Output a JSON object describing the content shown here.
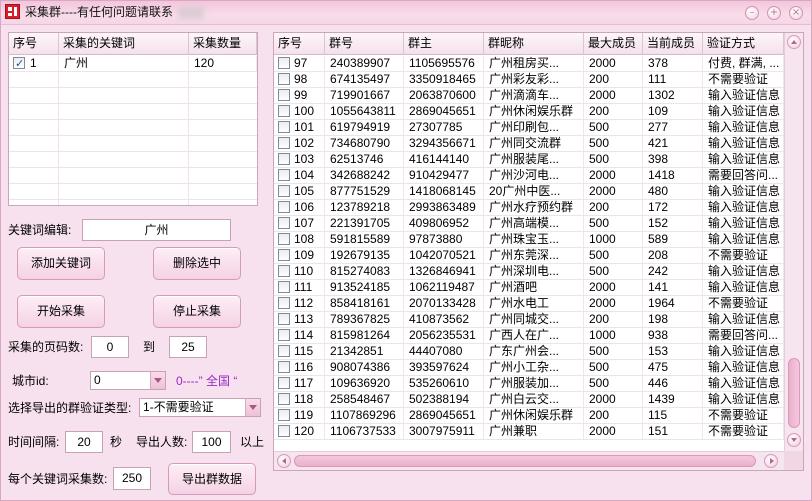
{
  "theme": {
    "background": "#f7e1ee",
    "accent": "#eab0cd",
    "hint_color": "#9a2bc5",
    "check_color": "#1f4fa0"
  },
  "window": {
    "title": "采集群----有任何问题请联系",
    "icon": "app-logo-icon",
    "controls": [
      "minimize-icon",
      "maximize-icon",
      "close-icon"
    ]
  },
  "keyword_table": {
    "columns": [
      "序号",
      "采集的关键词",
      "采集数量"
    ],
    "rows": [
      {
        "checked": true,
        "index": "1",
        "keyword": "广州",
        "count": "120"
      }
    ]
  },
  "keyword_editor": {
    "label": "关键词编辑:",
    "value": "广州"
  },
  "buttons": {
    "add_keyword": "添加关键词",
    "delete_selected": "删除选中",
    "start": "开始采集",
    "stop": "停止采集",
    "export": "导出群数据"
  },
  "page_range": {
    "label": "采集的页码数:",
    "from": "0",
    "separator": "到",
    "to": "25"
  },
  "city": {
    "label": "城市id:",
    "value": "0",
    "hint": "0----” 全国 “",
    "select_icon": "chevron-down-icon"
  },
  "export_type": {
    "label": "选择导出的群验证类型:",
    "value": "1-不需要验证",
    "select_icon": "chevron-down-icon"
  },
  "interval": {
    "label": "时间间隔:",
    "value": "20",
    "unit": "秒"
  },
  "export_min": {
    "label": "导出人数:",
    "value": "100",
    "suffix": "以上"
  },
  "per_keyword": {
    "label": "每个关键词采集数:",
    "value": "250"
  },
  "group_table": {
    "columns": [
      "序号",
      "群号",
      "群主",
      "群昵称",
      "最大成员",
      "当前成员",
      "验证方式"
    ],
    "scroll": {
      "vertical": 0.99,
      "horizontal": 0.0
    },
    "scrollbar_icons": [
      "up-arrow-icon",
      "down-arrow-icon",
      "left-arrow-icon",
      "right-arrow-icon"
    ],
    "rows": [
      {
        "checked": false,
        "no": "97",
        "qq": "240389907",
        "owner": "1105695576",
        "name": "广州租房买...",
        "max": "2000",
        "current": "378",
        "verify": "付费, 群满, ..."
      },
      {
        "checked": false,
        "no": "98",
        "qq": "674135497",
        "owner": "3350918465",
        "name": "广州彩友彩...",
        "max": "200",
        "current": "111",
        "verify": "不需要验证"
      },
      {
        "checked": false,
        "no": "99",
        "qq": "719901667",
        "owner": "2063870600",
        "name": "广州滴滴车...",
        "max": "2000",
        "current": "1302",
        "verify": "输入验证信息"
      },
      {
        "checked": false,
        "no": "100",
        "qq": "1055643811",
        "owner": "2869045651",
        "name": "广州休闲娱乐群",
        "max": "200",
        "current": "109",
        "verify": "输入验证信息"
      },
      {
        "checked": false,
        "no": "101",
        "qq": "619794919",
        "owner": "27307785",
        "name": "广州印刷包...",
        "max": "500",
        "current": "277",
        "verify": "输入验证信息"
      },
      {
        "checked": false,
        "no": "102",
        "qq": "734680790",
        "owner": "3294356671",
        "name": "广州同交流群",
        "max": "500",
        "current": "421",
        "verify": "输入验证信息"
      },
      {
        "checked": false,
        "no": "103",
        "qq": "62513746",
        "owner": "416144140",
        "name": "广州服装尾...",
        "max": "500",
        "current": "398",
        "verify": "输入验证信息"
      },
      {
        "checked": false,
        "no": "104",
        "qq": "342688242",
        "owner": "910429477",
        "name": "广州沙河电...",
        "max": "2000",
        "current": "1418",
        "verify": "需要回答问..."
      },
      {
        "checked": false,
        "no": "105",
        "qq": "877751529",
        "owner": "1418068145",
        "name": "20广州中医...",
        "max": "2000",
        "current": "480",
        "verify": "输入验证信息"
      },
      {
        "checked": false,
        "no": "106",
        "qq": "123789218",
        "owner": "2993863489",
        "name": "广州水疗预约群",
        "max": "200",
        "current": "172",
        "verify": "输入验证信息"
      },
      {
        "checked": false,
        "no": "107",
        "qq": "221391705",
        "owner": "409806952",
        "name": "广州高端模...",
        "max": "500",
        "current": "152",
        "verify": "输入验证信息"
      },
      {
        "checked": false,
        "no": "108",
        "qq": "591815589",
        "owner": "97873880",
        "name": "广州珠宝玉...",
        "max": "1000",
        "current": "589",
        "verify": "输入验证信息"
      },
      {
        "checked": false,
        "no": "109",
        "qq": "192679135",
        "owner": "1042070521",
        "name": "广州东莞深...",
        "max": "500",
        "current": "208",
        "verify": "不需要验证"
      },
      {
        "checked": false,
        "no": "110",
        "qq": "815274083",
        "owner": "1326846941",
        "name": "广州深圳电...",
        "max": "500",
        "current": "242",
        "verify": "输入验证信息"
      },
      {
        "checked": false,
        "no": "111",
        "qq": "913524185",
        "owner": "1062119487",
        "name": "广州酒吧",
        "max": "2000",
        "current": "141",
        "verify": "输入验证信息"
      },
      {
        "checked": false,
        "no": "112",
        "qq": "858418161",
        "owner": "2070133428",
        "name": "广州水电工",
        "max": "2000",
        "current": "1964",
        "verify": "不需要验证"
      },
      {
        "checked": false,
        "no": "113",
        "qq": "789367825",
        "owner": "410873562",
        "name": "广州同城交...",
        "max": "200",
        "current": "198",
        "verify": "输入验证信息"
      },
      {
        "checked": false,
        "no": "114",
        "qq": "815981264",
        "owner": "2056235531",
        "name": "广西人在广...",
        "max": "1000",
        "current": "938",
        "verify": "需要回答问..."
      },
      {
        "checked": false,
        "no": "115",
        "qq": "21342851",
        "owner": "44407080",
        "name": "广东广州会...",
        "max": "500",
        "current": "153",
        "verify": "输入验证信息"
      },
      {
        "checked": false,
        "no": "116",
        "qq": "908074386",
        "owner": "393597624",
        "name": "广州小工杂...",
        "max": "500",
        "current": "475",
        "verify": "输入验证信息"
      },
      {
        "checked": false,
        "no": "117",
        "qq": "109636920",
        "owner": "535260610",
        "name": "广州服装加...",
        "max": "500",
        "current": "446",
        "verify": "输入验证信息"
      },
      {
        "checked": false,
        "no": "118",
        "qq": "258548467",
        "owner": "502388194",
        "name": "广州白云交...",
        "max": "2000",
        "current": "1439",
        "verify": "输入验证信息"
      },
      {
        "checked": false,
        "no": "119",
        "qq": "1107869296",
        "owner": "2869045651",
        "name": "广州休闲娱乐群",
        "max": "200",
        "current": "115",
        "verify": "不需要验证"
      },
      {
        "checked": false,
        "no": "120",
        "qq": "1106737533",
        "owner": "3007975911",
        "name": "广州兼职",
        "max": "2000",
        "current": "151",
        "verify": "不需要验证"
      }
    ]
  }
}
